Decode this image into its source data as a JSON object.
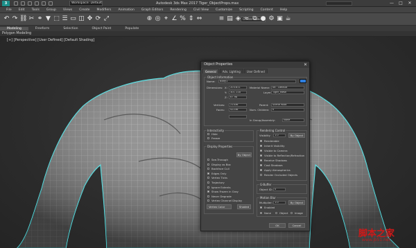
{
  "titlebar": {
    "workspace": "Workspace: Default",
    "title": "Autodesk 3ds Max 2017     Tiger_ObjectProps.max",
    "minimize": "—",
    "maximize": "□",
    "close": "✕"
  },
  "menu": [
    "File",
    "Edit",
    "Tools",
    "Group",
    "Views",
    "Create",
    "Modifiers",
    "Animation",
    "Graph Editors",
    "Rendering",
    "Civil View",
    "Customize",
    "Scripting",
    "Content",
    "Help"
  ],
  "toolbar": {
    "selection_set": "Create Selection Set",
    "icons": [
      "undo-icon",
      "redo-icon",
      "link-icon",
      "unlink-icon",
      "bind-icon",
      "filter-icon",
      "select-icon",
      "select-by-name-icon",
      "rect-select-icon",
      "window-crossing-icon",
      "move-icon",
      "rotate-icon",
      "scale-icon",
      "reference-coord-icon",
      "pivot-icon",
      "snap-icon",
      "angle-snap-icon",
      "percent-snap-icon",
      "spinner-snap-icon",
      "mirror-icon",
      "align-icon",
      "layer-icon",
      "graphite-icon",
      "curve-editor-icon",
      "schematic-icon",
      "material-editor-icon",
      "render-setup-icon",
      "render-frame-icon",
      "render-icon"
    ]
  },
  "ribbon": {
    "tabs": [
      "Modeling",
      "Freeform",
      "Selection",
      "Object Paint",
      "Populate"
    ],
    "active_tab": "Modeling",
    "panel_label": "Polygon Modeling"
  },
  "viewport": {
    "label": "[+] [Perspective] [User Defined] [Default Shading]"
  },
  "dialog": {
    "title": "Object Properties",
    "tabs": [
      "General",
      "Adv. Lighting",
      "User Defined"
    ],
    "object_information": {
      "group_title": "Object Information",
      "name_label": "Name:",
      "name_value": "Body1",
      "color": "#2f7fe0",
      "dimensions_label": "Dimensions:",
      "dim_x_label": "X:",
      "dim_x": "203.611",
      "dim_y_label": "Y:",
      "dim_y": "301.118",
      "dim_z_label": "Z:",
      "dim_z": "67.98",
      "material_label": "Material Name:",
      "material_value": "06 - Default",
      "layer_label": "Layer:",
      "layer_value": "Tiger_Mesh",
      "vertices_label": "Vertices:",
      "vertices": "21436",
      "faces_label": "Faces:",
      "faces": "42236",
      "parent_label": "Parent:",
      "parent_value": "Scene Root",
      "children_label": "Num. Children:",
      "children_value": "0",
      "group_label": "In Group/Assembly:",
      "group_value": "None"
    },
    "interactivity": {
      "title": "Interactivity",
      "items": [
        {
          "label": "Hide",
          "checked": false
        },
        {
          "label": "Freeze",
          "checked": false
        }
      ]
    },
    "display_properties": {
      "title": "Display Properties",
      "by_object": "By Object",
      "items": [
        {
          "label": "See-Through",
          "checked": false
        },
        {
          "label": "Display as Box",
          "checked": false
        },
        {
          "label": "Backface Cull",
          "checked": false
        },
        {
          "label": "Edges Only",
          "checked": true
        },
        {
          "label": "Vertex Ticks",
          "checked": false
        },
        {
          "label": "Trajectory",
          "checked": false
        },
        {
          "label": "Ignore Extents",
          "checked": false
        },
        {
          "label": "Show Frozen in Gray",
          "checked": true
        },
        {
          "label": "Never Degrade",
          "checked": false
        },
        {
          "label": "Vertex Channel Display",
          "checked": false
        }
      ],
      "vertex_color_label": "Vertex Color",
      "shaded": "Shaded"
    },
    "rendering_control": {
      "title": "Rendering Control",
      "visibility_label": "Visibility",
      "visibility_value": "1.0",
      "by_object": "By Object",
      "items": [
        {
          "label": "Renderable",
          "checked": true
        },
        {
          "label": "Inherit Visibility",
          "checked": true
        },
        {
          "label": "Visible to Camera",
          "checked": true
        },
        {
          "label": "Visible to Reflection/Refraction",
          "checked": true
        },
        {
          "label": "Receive Shadows",
          "checked": true
        },
        {
          "label": "Cast Shadows",
          "checked": true
        },
        {
          "label": "Apply Atmospherics",
          "checked": true
        },
        {
          "label": "Render Occluded Objects",
          "checked": false
        }
      ]
    },
    "gbuffer": {
      "title": "G-Buffer",
      "object_id_label": "Object ID:",
      "object_id": "0"
    },
    "motion_blur": {
      "title": "Motion Blur",
      "multiplier_label": "Multiplier:",
      "multiplier": "1.0",
      "by_object": "By Object",
      "enabled_label": "Enabled",
      "enabled": true,
      "options": [
        "None",
        "Object",
        "Image"
      ],
      "selected": "None"
    },
    "ok": "OK",
    "cancel": "Cancel"
  },
  "watermark": {
    "cn": "脚本之家",
    "url": "www.jb51.net"
  }
}
